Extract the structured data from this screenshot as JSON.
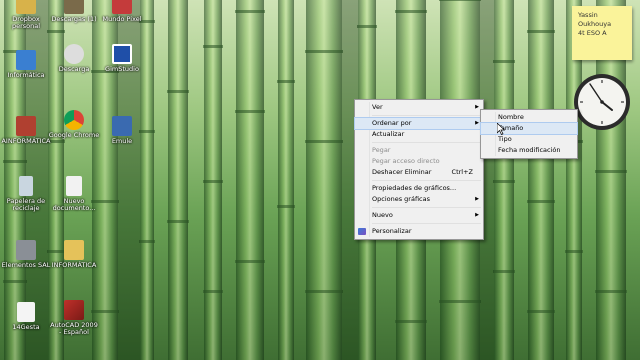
{
  "desktop_icons": [
    {
      "label": "Dropbox personal",
      "icon": "folder-icon",
      "color": "#d8b24a"
    },
    {
      "label": "Descargas (1)",
      "icon": "folder-icon",
      "color": "#7a6a4a"
    },
    {
      "label": "Mundo Pixel",
      "icon": "app-icon",
      "color": "#c43b3b"
    },
    {
      "label": "Informática",
      "icon": "app-icon",
      "color": "#3a7fd1"
    },
    {
      "label": "Descarga",
      "icon": "seal-icon",
      "color": "#dddddd"
    },
    {
      "label": "GimStudio",
      "icon": "app-icon",
      "color": "#1f4fa8"
    },
    {
      "label": "AINFORMÁTICA",
      "icon": "app-icon",
      "color": "#b04030"
    },
    {
      "label": "Google Chrome",
      "icon": "chrome-icon",
      "color": "#e8b030"
    },
    {
      "label": "Emule",
      "icon": "app-icon",
      "color": "#3a6ab0"
    },
    {
      "label": "Papelera de reciclaje",
      "icon": "recycle-bin-icon",
      "color": "#c9d6e0"
    },
    {
      "label": "Nuevo documento...",
      "icon": "document-icon",
      "color": "#f2f2f2"
    },
    {
      "label": "Elementos SAL",
      "icon": "app-icon",
      "color": "#8a8f96"
    },
    {
      "label": "INFORMÁTICA",
      "icon": "folder-icon",
      "color": "#e5c25a"
    },
    {
      "label": "14Gesta",
      "icon": "document-icon",
      "color": "#f4f4f4"
    },
    {
      "label": "AutoCAD 2009 - Español",
      "icon": "autocad-icon",
      "color": "#c0302a"
    }
  ],
  "sticky_note": {
    "line1": "Yassin",
    "line2": "Oukhouya",
    "line3": "4t ESO A"
  },
  "context_menu": {
    "items": [
      {
        "label": "Ver",
        "submenu": true,
        "disabled": false
      },
      {
        "label": "Ordenar por",
        "submenu": true,
        "disabled": false,
        "highlighted": true
      },
      {
        "label": "Actualizar",
        "submenu": false,
        "disabled": false
      },
      {
        "label": "Pegar",
        "submenu": false,
        "disabled": true
      },
      {
        "label": "Pegar acceso directo",
        "submenu": false,
        "disabled": true
      },
      {
        "label": "Deshacer Eliminar",
        "submenu": false,
        "disabled": false,
        "shortcut": "Ctrl+Z"
      },
      {
        "label": "Propiedades de gráficos...",
        "submenu": false,
        "disabled": false
      },
      {
        "label": "Opciones gráficas",
        "submenu": true,
        "disabled": false
      },
      {
        "label": "Nuevo",
        "submenu": true,
        "disabled": false
      },
      {
        "label": "Personalizar",
        "submenu": false,
        "disabled": false,
        "icon": "personalize-icon"
      }
    ]
  },
  "submenu": {
    "items": [
      {
        "label": "Nombre"
      },
      {
        "label": "Tamaño",
        "highlighted": true
      },
      {
        "label": "Tipo"
      },
      {
        "label": "Fecha modificación"
      }
    ]
  },
  "colors": {
    "menu_bg": "#f0f0f0",
    "highlight": "#dce8f5",
    "note": "#faf39a"
  }
}
